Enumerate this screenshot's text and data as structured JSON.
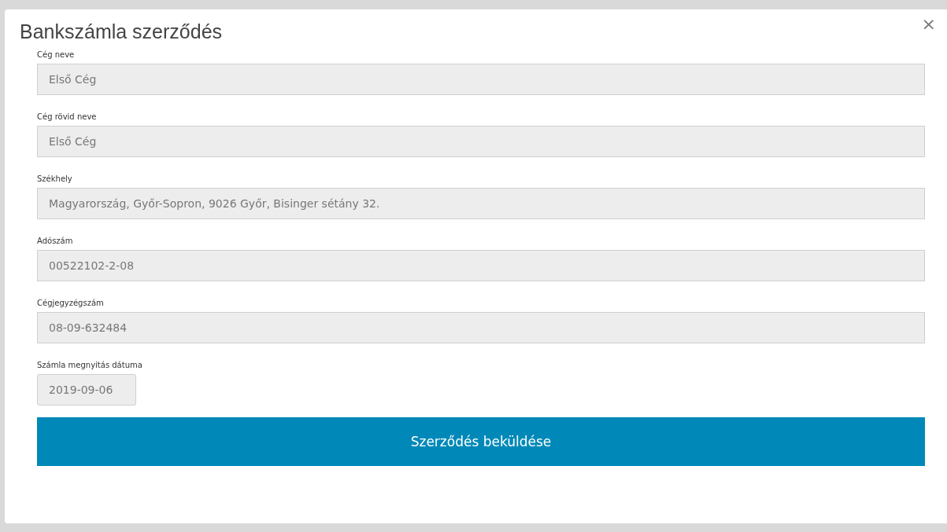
{
  "dialog": {
    "title": "Bankszámla szerződés",
    "close": "×"
  },
  "fields": [
    {
      "label": "Cég neve",
      "value": "Első Cég",
      "kind": "text"
    },
    {
      "label": "Cég rövid neve",
      "value": "Első Cég",
      "kind": "text"
    },
    {
      "label": "Székhely",
      "value": "Magyarország, Győr-Sopron, 9026 Győr, Bisinger sétány 32.",
      "kind": "text"
    },
    {
      "label": "Adószám",
      "value": "00522102-2-08",
      "kind": "text"
    },
    {
      "label": "Cégjegyzégszám",
      "value": "08-09-632484",
      "kind": "text"
    },
    {
      "label": "Számla megnyitás dátuma",
      "value": "2019-09-06",
      "kind": "date"
    }
  ],
  "submit": "Szerződés beküldése"
}
